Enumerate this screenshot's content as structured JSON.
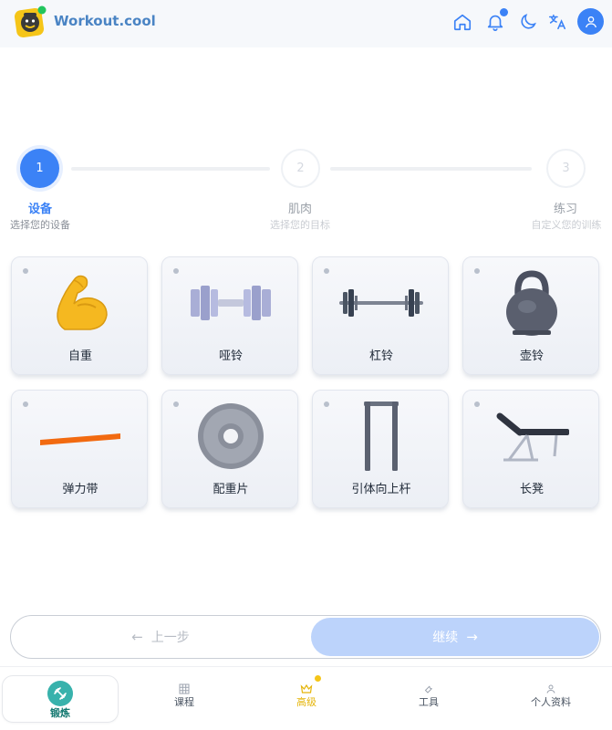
{
  "header": {
    "brand": "Workout.cool",
    "icons": [
      "home-icon",
      "bell-icon",
      "moon-icon",
      "translate-icon",
      "user-icon"
    ],
    "accent": "#3b82f6"
  },
  "stepper": {
    "steps": [
      {
        "number": "1",
        "title": "设备",
        "subtitle": "选择您的设备",
        "state": "active"
      },
      {
        "number": "2",
        "title": "肌肉",
        "subtitle": "选择您的目标",
        "state": "pending"
      },
      {
        "number": "3",
        "title": "练习",
        "subtitle": "自定义您的训练",
        "state": "pending"
      }
    ]
  },
  "equipment": [
    {
      "label": "自重",
      "icon": "flexed-biceps-icon"
    },
    {
      "label": "哑铃",
      "icon": "dumbbell-icon"
    },
    {
      "label": "杠铃",
      "icon": "barbell-icon"
    },
    {
      "label": "壶铃",
      "icon": "kettlebell-icon"
    },
    {
      "label": "弹力带",
      "icon": "resistance-band-icon"
    },
    {
      "label": "配重片",
      "icon": "weight-plate-icon"
    },
    {
      "label": "引体向上杆",
      "icon": "pull-up-bar-icon"
    },
    {
      "label": "长凳",
      "icon": "bench-icon"
    }
  ],
  "navigation": {
    "prev_label": "上一步",
    "next_label": "继续",
    "next_color": "#bcd3fb"
  },
  "tabs": [
    {
      "label": "锻炼",
      "icon": "workout-icon",
      "active": true
    },
    {
      "label": "课程",
      "icon": "grid-icon",
      "active": false
    },
    {
      "label": "高级",
      "icon": "crown-icon",
      "active": false,
      "color": "#e5b50a"
    },
    {
      "label": "工具",
      "icon": "wrench-icon",
      "active": false
    },
    {
      "label": "个人资料",
      "icon": "user-icon",
      "active": false
    }
  ]
}
